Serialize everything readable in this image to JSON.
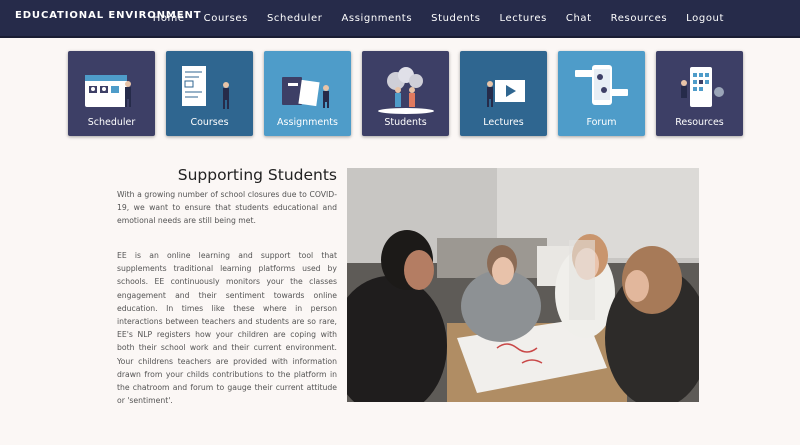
{
  "brand": "EDUCATIONAL ENVIRONMENT",
  "nav": [
    "Home",
    "Courses",
    "Scheduler",
    "Assignments",
    "Students",
    "Lectures",
    "Chat",
    "Resources",
    "Logout"
  ],
  "tiles": [
    {
      "label": "Scheduler",
      "icon": "calendar-icon",
      "color": "#3d3f66"
    },
    {
      "label": "Courses",
      "icon": "whiteboard-icon",
      "color": "#2f6690"
    },
    {
      "label": "Assignments",
      "icon": "notebook-icon",
      "color": "#4e9cc9"
    },
    {
      "label": "Students",
      "icon": "students-icon",
      "color": "#3d3f66"
    },
    {
      "label": "Lectures",
      "icon": "video-icon",
      "color": "#2f6690"
    },
    {
      "label": "Forum",
      "icon": "chat-phone-icon",
      "color": "#4e9cc9"
    },
    {
      "label": "Resources",
      "icon": "tablet-icon",
      "color": "#3d3f66"
    }
  ],
  "content": {
    "heading": "Supporting Students",
    "p1": "With a growing number of school closures due to COVID-19, we want to ensure that students educational and emotional needs are still being met.",
    "p2": "EE is an online learning and support tool that supplements traditional learning platforms used by schools. EE continuously monitors your the classes engagement and their sentiment towards online education. In times like these where in person interactions between teachers and students are so rare, EE's NLP registers how your children are coping with both their school work and their current environment. Your childrens teachers are provided with information drawn from your childs contributions to the platform in the chatroom and forum to gauge their current attitude or 'sentiment'."
  }
}
